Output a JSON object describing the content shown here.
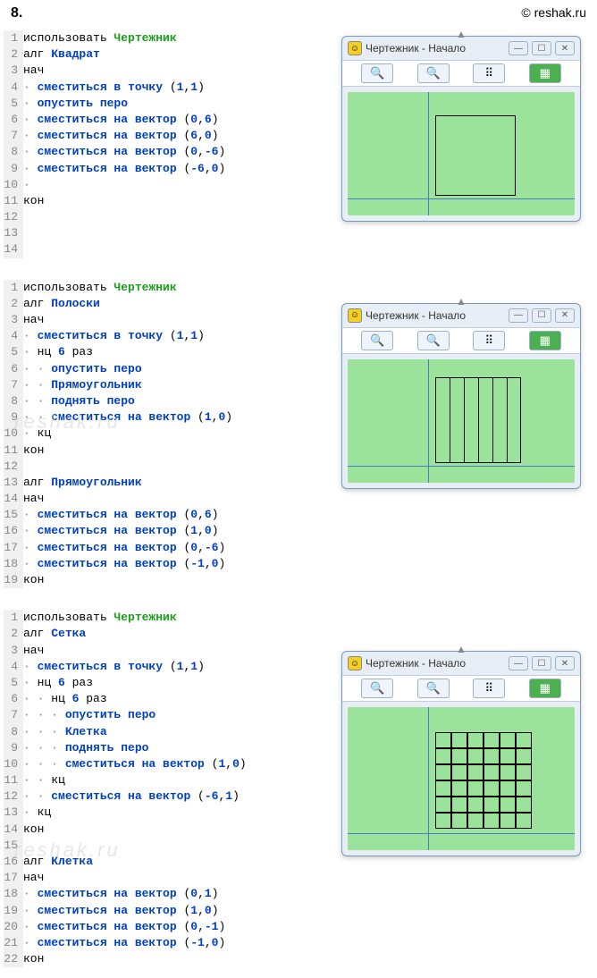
{
  "header": {
    "task_num": "8.",
    "copyright": "© reshak.ru"
  },
  "watermark": {
    "text": "reshak.ru"
  },
  "window": {
    "title": "Чертежник - Начало",
    "icon": "☺",
    "controls": {
      "min": "—",
      "max": "☐",
      "close": "✕"
    },
    "toolbar": {
      "zoom_in": "🔍+",
      "zoom_out": "🔍-",
      "grid": "⠿",
      "reset": "▦"
    }
  },
  "prog1": {
    "lines": [
      {
        "n": "1",
        "tokens": [
          {
            "t": "использовать ",
            "c": "kw-black"
          },
          {
            "t": "Чертежник",
            "c": "kw-green"
          }
        ]
      },
      {
        "n": "2",
        "tokens": [
          {
            "t": "алг ",
            "c": "kw-black"
          },
          {
            "t": "Квадрат",
            "c": "kw-blue"
          }
        ]
      },
      {
        "n": "3",
        "tokens": [
          {
            "t": "нач",
            "c": "kw-black"
          }
        ]
      },
      {
        "n": "4",
        "tokens": [
          {
            "t": "· ",
            "c": "dot"
          },
          {
            "t": "сместиться в точку ",
            "c": "kw-blue"
          },
          {
            "t": "(",
            "c": "punct"
          },
          {
            "t": "1",
            "c": "num"
          },
          {
            "t": ",",
            "c": "punct"
          },
          {
            "t": "1",
            "c": "num"
          },
          {
            "t": ")",
            "c": "punct"
          }
        ]
      },
      {
        "n": "5",
        "tokens": [
          {
            "t": "· ",
            "c": "dot"
          },
          {
            "t": "опустить перо",
            "c": "kw-blue"
          }
        ]
      },
      {
        "n": "6",
        "tokens": [
          {
            "t": "· ",
            "c": "dot"
          },
          {
            "t": "сместиться на вектор ",
            "c": "kw-blue"
          },
          {
            "t": "(",
            "c": "punct"
          },
          {
            "t": "0",
            "c": "num"
          },
          {
            "t": ",",
            "c": "punct"
          },
          {
            "t": "6",
            "c": "num"
          },
          {
            "t": ")",
            "c": "punct"
          }
        ]
      },
      {
        "n": "7",
        "tokens": [
          {
            "t": "· ",
            "c": "dot"
          },
          {
            "t": "сместиться на вектор ",
            "c": "kw-blue"
          },
          {
            "t": "(",
            "c": "punct"
          },
          {
            "t": "6",
            "c": "num"
          },
          {
            "t": ",",
            "c": "punct"
          },
          {
            "t": "0",
            "c": "num"
          },
          {
            "t": ")",
            "c": "punct"
          }
        ]
      },
      {
        "n": "8",
        "tokens": [
          {
            "t": "· ",
            "c": "dot"
          },
          {
            "t": "сместиться на вектор ",
            "c": "kw-blue"
          },
          {
            "t": "(",
            "c": "punct"
          },
          {
            "t": "0",
            "c": "num"
          },
          {
            "t": ",",
            "c": "punct"
          },
          {
            "t": "-6",
            "c": "num"
          },
          {
            "t": ")",
            "c": "punct"
          }
        ]
      },
      {
        "n": "9",
        "tokens": [
          {
            "t": "· ",
            "c": "dot"
          },
          {
            "t": "сместиться на вектор ",
            "c": "kw-blue"
          },
          {
            "t": "(",
            "c": "punct"
          },
          {
            "t": "-6",
            "c": "num"
          },
          {
            "t": ",",
            "c": "punct"
          },
          {
            "t": "0",
            "c": "num"
          },
          {
            "t": ")",
            "c": "punct"
          }
        ]
      },
      {
        "n": "10",
        "tokens": [
          {
            "t": "·",
            "c": "dot"
          }
        ]
      },
      {
        "n": "11",
        "tokens": [
          {
            "t": "кон",
            "c": "kw-black"
          }
        ]
      },
      {
        "n": "12",
        "tokens": []
      },
      {
        "n": "13",
        "tokens": []
      },
      {
        "n": "14",
        "tokens": []
      }
    ]
  },
  "prog2": {
    "lines": [
      {
        "n": "1",
        "tokens": [
          {
            "t": "использовать ",
            "c": "kw-black"
          },
          {
            "t": "Чертежник",
            "c": "kw-green"
          }
        ]
      },
      {
        "n": "2",
        "tokens": [
          {
            "t": "алг ",
            "c": "kw-black"
          },
          {
            "t": "Полоски",
            "c": "kw-blue"
          }
        ]
      },
      {
        "n": "3",
        "tokens": [
          {
            "t": "нач",
            "c": "kw-black"
          }
        ]
      },
      {
        "n": "4",
        "tokens": [
          {
            "t": "· ",
            "c": "dot"
          },
          {
            "t": "сместиться в точку ",
            "c": "kw-blue"
          },
          {
            "t": "(",
            "c": "punct"
          },
          {
            "t": "1",
            "c": "num"
          },
          {
            "t": ",",
            "c": "punct"
          },
          {
            "t": "1",
            "c": "num"
          },
          {
            "t": ")",
            "c": "punct"
          }
        ]
      },
      {
        "n": "5",
        "tokens": [
          {
            "t": "· ",
            "c": "dot"
          },
          {
            "t": "нц ",
            "c": "kw-black"
          },
          {
            "t": "6",
            "c": "num"
          },
          {
            "t": " раз",
            "c": "kw-black"
          }
        ]
      },
      {
        "n": "6",
        "tokens": [
          {
            "t": "· · ",
            "c": "dot"
          },
          {
            "t": "опустить перо",
            "c": "kw-blue"
          }
        ]
      },
      {
        "n": "7",
        "tokens": [
          {
            "t": "· · ",
            "c": "dot"
          },
          {
            "t": "Прямоугольник",
            "c": "kw-blue"
          }
        ]
      },
      {
        "n": "8",
        "tokens": [
          {
            "t": "· · ",
            "c": "dot"
          },
          {
            "t": "поднять перо",
            "c": "kw-blue"
          }
        ]
      },
      {
        "n": "9",
        "tokens": [
          {
            "t": "· · ",
            "c": "dot"
          },
          {
            "t": "сместиться на вектор ",
            "c": "kw-blue"
          },
          {
            "t": "(",
            "c": "punct"
          },
          {
            "t": "1",
            "c": "num"
          },
          {
            "t": ",",
            "c": "punct"
          },
          {
            "t": "0",
            "c": "num"
          },
          {
            "t": ")",
            "c": "punct"
          }
        ]
      },
      {
        "n": "10",
        "tokens": [
          {
            "t": "· ",
            "c": "dot"
          },
          {
            "t": "кц",
            "c": "kw-black"
          }
        ]
      },
      {
        "n": "11",
        "tokens": [
          {
            "t": "кон",
            "c": "kw-black"
          }
        ]
      },
      {
        "n": "12",
        "tokens": []
      },
      {
        "n": "13",
        "tokens": [
          {
            "t": "алг ",
            "c": "kw-black"
          },
          {
            "t": "Прямоугольник",
            "c": "kw-blue"
          }
        ]
      },
      {
        "n": "14",
        "tokens": [
          {
            "t": "нач",
            "c": "kw-black"
          }
        ]
      },
      {
        "n": "15",
        "tokens": [
          {
            "t": "· ",
            "c": "dot"
          },
          {
            "t": "сместиться на вектор ",
            "c": "kw-blue"
          },
          {
            "t": "(",
            "c": "punct"
          },
          {
            "t": "0",
            "c": "num"
          },
          {
            "t": ",",
            "c": "punct"
          },
          {
            "t": "6",
            "c": "num"
          },
          {
            "t": ")",
            "c": "punct"
          }
        ]
      },
      {
        "n": "16",
        "tokens": [
          {
            "t": "· ",
            "c": "dot"
          },
          {
            "t": "сместиться на вектор ",
            "c": "kw-blue"
          },
          {
            "t": "(",
            "c": "punct"
          },
          {
            "t": "1",
            "c": "num"
          },
          {
            "t": ",",
            "c": "punct"
          },
          {
            "t": "0",
            "c": "num"
          },
          {
            "t": ")",
            "c": "punct"
          }
        ]
      },
      {
        "n": "17",
        "tokens": [
          {
            "t": "· ",
            "c": "dot"
          },
          {
            "t": "сместиться на вектор ",
            "c": "kw-blue"
          },
          {
            "t": "(",
            "c": "punct"
          },
          {
            "t": "0",
            "c": "num"
          },
          {
            "t": ",",
            "c": "punct"
          },
          {
            "t": "-6",
            "c": "num"
          },
          {
            "t": ")",
            "c": "punct"
          }
        ]
      },
      {
        "n": "18",
        "tokens": [
          {
            "t": "· ",
            "c": "dot"
          },
          {
            "t": "сместиться на вектор ",
            "c": "kw-blue"
          },
          {
            "t": "(",
            "c": "punct"
          },
          {
            "t": "-1",
            "c": "num"
          },
          {
            "t": ",",
            "c": "punct"
          },
          {
            "t": "0",
            "c": "num"
          },
          {
            "t": ")",
            "c": "punct"
          }
        ]
      },
      {
        "n": "19",
        "tokens": [
          {
            "t": "кон",
            "c": "kw-black"
          }
        ]
      }
    ]
  },
  "prog3": {
    "lines": [
      {
        "n": "1",
        "tokens": [
          {
            "t": "использовать ",
            "c": "kw-black"
          },
          {
            "t": "Чертежник",
            "c": "kw-green"
          }
        ]
      },
      {
        "n": "2",
        "tokens": [
          {
            "t": "алг ",
            "c": "kw-black"
          },
          {
            "t": "Сетка",
            "c": "kw-blue"
          }
        ]
      },
      {
        "n": "3",
        "tokens": [
          {
            "t": "нач",
            "c": "kw-black"
          }
        ]
      },
      {
        "n": "4",
        "tokens": [
          {
            "t": "· ",
            "c": "dot"
          },
          {
            "t": "сместиться в точку ",
            "c": "kw-blue"
          },
          {
            "t": "(",
            "c": "punct"
          },
          {
            "t": "1",
            "c": "num"
          },
          {
            "t": ",",
            "c": "punct"
          },
          {
            "t": "1",
            "c": "num"
          },
          {
            "t": ")",
            "c": "punct"
          }
        ]
      },
      {
        "n": "5",
        "tokens": [
          {
            "t": "· ",
            "c": "dot"
          },
          {
            "t": "нц ",
            "c": "kw-black"
          },
          {
            "t": "6",
            "c": "num"
          },
          {
            "t": " раз",
            "c": "kw-black"
          }
        ]
      },
      {
        "n": "6",
        "tokens": [
          {
            "t": "· · ",
            "c": "dot"
          },
          {
            "t": "нц ",
            "c": "kw-black"
          },
          {
            "t": "6",
            "c": "num"
          },
          {
            "t": " раз",
            "c": "kw-black"
          }
        ]
      },
      {
        "n": "7",
        "tokens": [
          {
            "t": "· · · ",
            "c": "dot"
          },
          {
            "t": "опустить перо",
            "c": "kw-blue"
          }
        ]
      },
      {
        "n": "8",
        "tokens": [
          {
            "t": "· · · ",
            "c": "dot"
          },
          {
            "t": "Клетка",
            "c": "kw-blue"
          }
        ]
      },
      {
        "n": "9",
        "tokens": [
          {
            "t": "· · · ",
            "c": "dot"
          },
          {
            "t": "поднять перо",
            "c": "kw-blue"
          }
        ]
      },
      {
        "n": "10",
        "tokens": [
          {
            "t": "· · · ",
            "c": "dot"
          },
          {
            "t": "сместиться на вектор ",
            "c": "kw-blue"
          },
          {
            "t": "(",
            "c": "punct"
          },
          {
            "t": "1",
            "c": "num"
          },
          {
            "t": ",",
            "c": "punct"
          },
          {
            "t": "0",
            "c": "num"
          },
          {
            "t": ")",
            "c": "punct"
          }
        ]
      },
      {
        "n": "11",
        "tokens": [
          {
            "t": "· · ",
            "c": "dot"
          },
          {
            "t": "кц",
            "c": "kw-black"
          }
        ]
      },
      {
        "n": "12",
        "tokens": [
          {
            "t": "· · ",
            "c": "dot"
          },
          {
            "t": "сместиться на вектор ",
            "c": "kw-blue"
          },
          {
            "t": "(",
            "c": "punct"
          },
          {
            "t": "-6",
            "c": "num"
          },
          {
            "t": ",",
            "c": "punct"
          },
          {
            "t": "1",
            "c": "num"
          },
          {
            "t": ")",
            "c": "punct"
          }
        ]
      },
      {
        "n": "13",
        "tokens": [
          {
            "t": "· ",
            "c": "dot"
          },
          {
            "t": "кц",
            "c": "kw-black"
          }
        ]
      },
      {
        "n": "14",
        "tokens": [
          {
            "t": "кон",
            "c": "kw-black"
          }
        ]
      },
      {
        "n": "15",
        "tokens": []
      },
      {
        "n": "16",
        "tokens": [
          {
            "t": "алг ",
            "c": "kw-black"
          },
          {
            "t": "Клетка",
            "c": "kw-blue"
          }
        ]
      },
      {
        "n": "17",
        "tokens": [
          {
            "t": "нач",
            "c": "kw-black"
          }
        ]
      },
      {
        "n": "18",
        "tokens": [
          {
            "t": "· ",
            "c": "dot"
          },
          {
            "t": "сместиться на вектор ",
            "c": "kw-blue"
          },
          {
            "t": "(",
            "c": "punct"
          },
          {
            "t": "0",
            "c": "num"
          },
          {
            "t": ",",
            "c": "punct"
          },
          {
            "t": "1",
            "c": "num"
          },
          {
            "t": ")",
            "c": "punct"
          }
        ]
      },
      {
        "n": "19",
        "tokens": [
          {
            "t": "· ",
            "c": "dot"
          },
          {
            "t": "сместиться на вектор ",
            "c": "kw-blue"
          },
          {
            "t": "(",
            "c": "punct"
          },
          {
            "t": "1",
            "c": "num"
          },
          {
            "t": ",",
            "c": "punct"
          },
          {
            "t": "0",
            "c": "num"
          },
          {
            "t": ")",
            "c": "punct"
          }
        ]
      },
      {
        "n": "20",
        "tokens": [
          {
            "t": "· ",
            "c": "dot"
          },
          {
            "t": "сместиться на вектор ",
            "c": "kw-blue"
          },
          {
            "t": "(",
            "c": "punct"
          },
          {
            "t": "0",
            "c": "num"
          },
          {
            "t": ",",
            "c": "punct"
          },
          {
            "t": "-1",
            "c": "num"
          },
          {
            "t": ")",
            "c": "punct"
          }
        ]
      },
      {
        "n": "21",
        "tokens": [
          {
            "t": "· ",
            "c": "dot"
          },
          {
            "t": "сместиться на вектор ",
            "c": "kw-blue"
          },
          {
            "t": "(",
            "c": "punct"
          },
          {
            "t": "-1",
            "c": "num"
          },
          {
            "t": ",",
            "c": "punct"
          },
          {
            "t": "0",
            "c": "num"
          },
          {
            "t": ")",
            "c": "punct"
          }
        ]
      },
      {
        "n": "22",
        "tokens": [
          {
            "t": "кон",
            "c": "kw-black"
          }
        ]
      }
    ]
  }
}
